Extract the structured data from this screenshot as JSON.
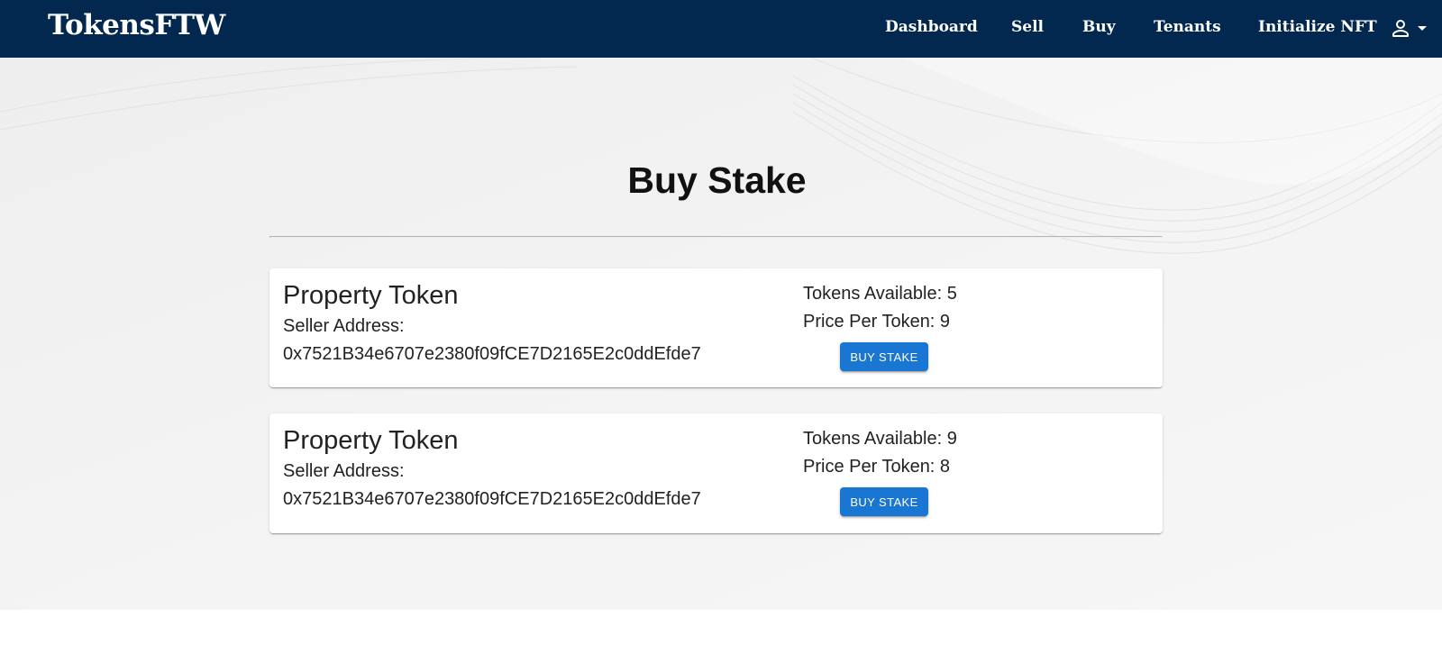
{
  "app": {
    "brand": "TokensFTW"
  },
  "nav": {
    "links": [
      "Dashboard",
      "Sell",
      "Buy",
      "Tenants",
      "Initialize NFT"
    ],
    "account_icon": "person-outline-icon",
    "dropdown_icon": "caret-down-icon"
  },
  "page": {
    "title": "Buy Stake"
  },
  "listings": [
    {
      "title": "Property Token",
      "seller_label": "Seller Address:",
      "seller_address": "0x7521B34e6707e2380f09fCE7D2165E2c0ddEfde7",
      "tokens_available": "Tokens Available: 5",
      "price_per_token": "Price Per Token: 9",
      "button": "BUY STAKE"
    },
    {
      "title": "Property Token",
      "seller_label": "Seller Address:",
      "seller_address": "0x7521B34e6707e2380f09fCE7D2165E2c0ddEfde7",
      "tokens_available": "Tokens Available: 9",
      "price_per_token": "Price Per Token: 8",
      "button": "BUY STAKE"
    }
  ],
  "colors": {
    "navbar": "#03284f",
    "primary_button": "#1976d2",
    "background": "#f3f3f3"
  }
}
